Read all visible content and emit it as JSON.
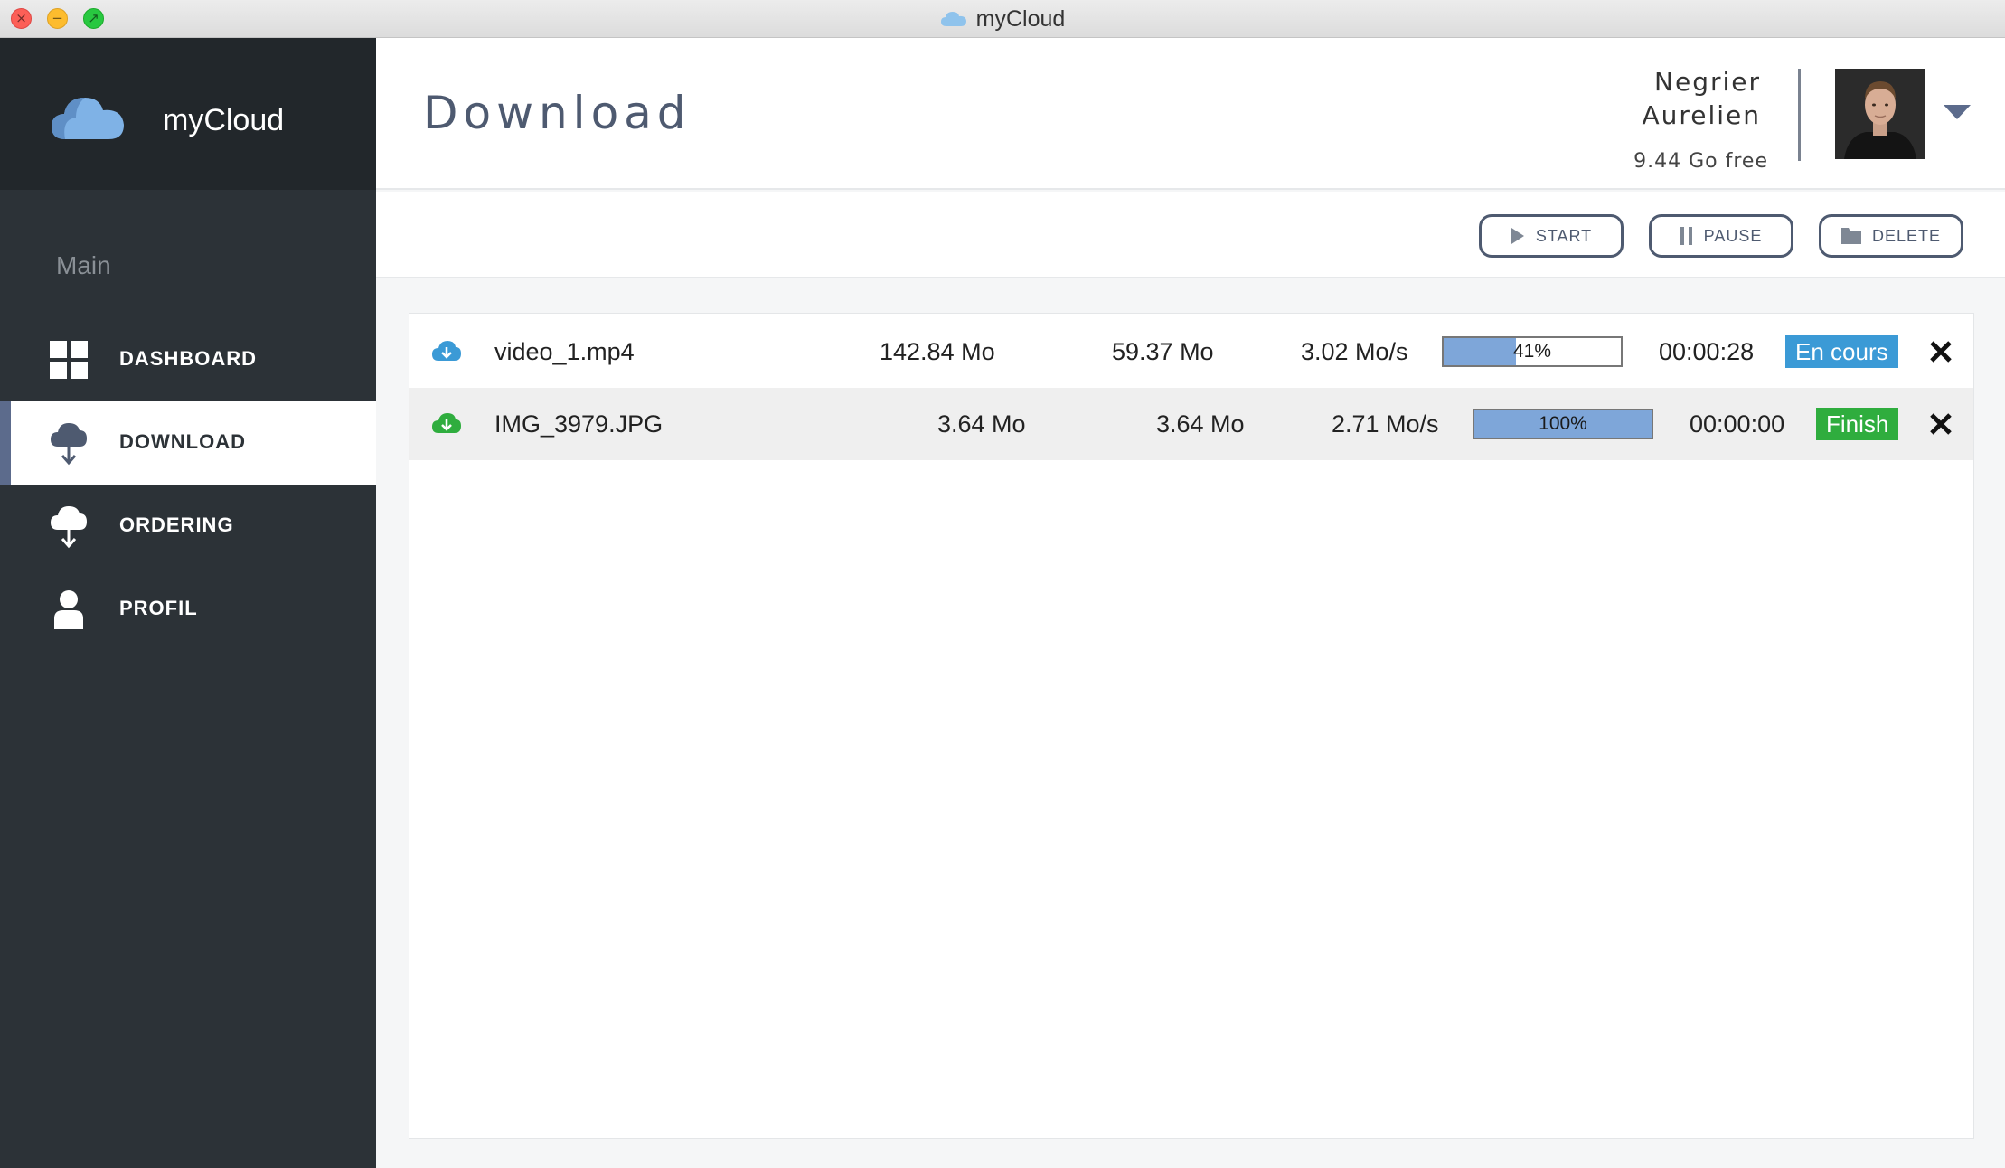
{
  "window": {
    "title": "myCloud"
  },
  "sidebar": {
    "brand": "myCloud",
    "section_title": "Main",
    "items": [
      {
        "label": "DASHBOARD",
        "icon": "grid-icon",
        "active": false
      },
      {
        "label": "DOWNLOAD",
        "icon": "cloud-download-icon",
        "active": true
      },
      {
        "label": "ORDERING",
        "icon": "cloud-upload-icon",
        "active": false
      },
      {
        "label": "PROFIL",
        "icon": "user-icon",
        "active": false
      }
    ]
  },
  "header": {
    "page_title": "Download",
    "user": {
      "first_line": "Negrier",
      "second_line": "Aurelien",
      "storage": "9.44 Go free"
    }
  },
  "toolbar": {
    "start": "START",
    "pause": "PAUSE",
    "delete": "DELETE"
  },
  "downloads": [
    {
      "icon_color": "#3b9ad6",
      "name": "video_1.mp4",
      "size": "142.84 Mo",
      "downloaded": "59.37 Mo",
      "speed": "3.02 Mo/s",
      "progress": 0.41,
      "progress_label": "41%",
      "time": "00:00:28",
      "status": "En cours",
      "status_color": "#3b9ad6"
    },
    {
      "icon_color": "#2fad3e",
      "name": "IMG_3979.JPG",
      "size": "3.64 Mo",
      "downloaded": "3.64 Mo",
      "speed": "2.71 Mo/s",
      "progress": 1.0,
      "progress_label": "100%",
      "time": "00:00:00",
      "status": "Finish",
      "status_color": "#2fad3e"
    }
  ],
  "colors": {
    "accent": "#4e5a70",
    "sidebar_bg": "#2c3237",
    "progress_fill": "#7ea6d9"
  }
}
